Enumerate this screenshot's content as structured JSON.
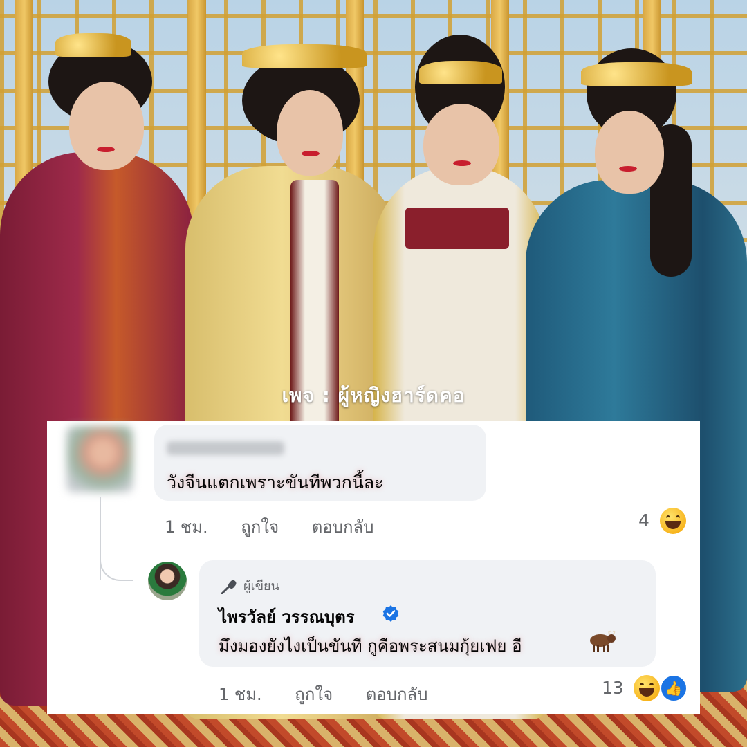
{
  "watermark": "เพจ : ผู้หญิงฮาร์ดคอ",
  "comment1": {
    "text": "วังจีนแตกเพราะขันทีพวกนี้ละ",
    "time": "1 ชม.",
    "like_label": "ถูกใจ",
    "reply_label": "ตอบกลับ",
    "reaction_count": "4",
    "reaction_icon": "haha-emoji-icon"
  },
  "comment2": {
    "author_badge": "ผู้เขียน",
    "author_name": "ไพรวัลย์ วรรณบุตร",
    "text": "มึงมองยังไงเป็นขันที กูคือพระสนมกุ้ยเฟย อี",
    "time": "1 ชม.",
    "like_label": "ถูกใจ",
    "reply_label": "ตอบกลับ",
    "reaction_count": "13",
    "reaction_icons": [
      "haha-emoji-icon",
      "like-icon"
    ]
  },
  "colors": {
    "card_bg": "#ffffff",
    "bubble_bg": "#f0f2f5",
    "meta_text": "#65676b",
    "verified_blue": "#1b74e4"
  }
}
